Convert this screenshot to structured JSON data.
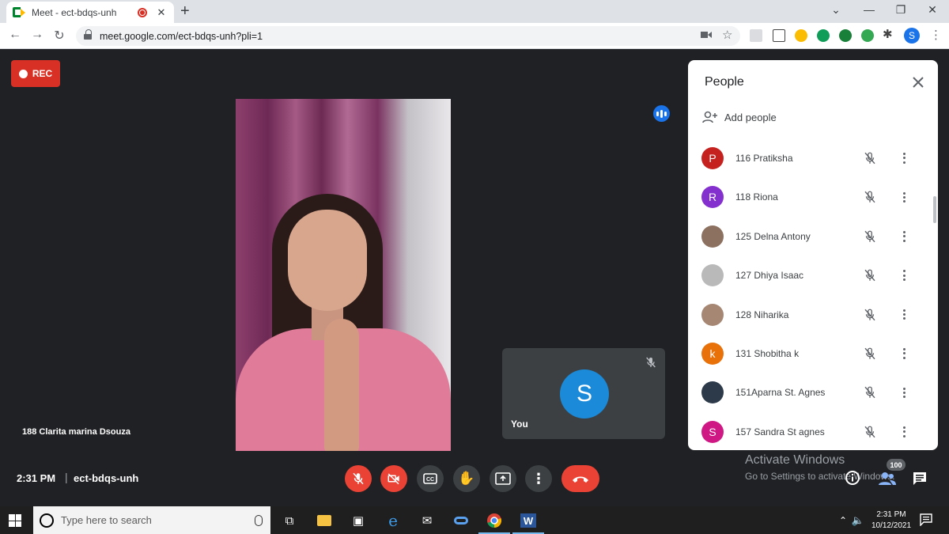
{
  "browser": {
    "tab_title": "Meet - ect-bdqs-unh",
    "tab_close": "✕",
    "new_tab": "+",
    "url": "meet.google.com/ect-bdqs-unh?pli=1",
    "profile_initial": "S",
    "window_controls": [
      "⌄",
      "—",
      "❐",
      "✕"
    ]
  },
  "meet": {
    "rec_label": "REC",
    "speaker_name": "188 Clarita marina Dsouza",
    "self_tile": {
      "initial": "S",
      "label": "You"
    },
    "clock": "2:31 PM",
    "separator": "|",
    "meeting_code": "ect-bdqs-unh",
    "participant_count": "100",
    "colors": {
      "accent": "#1a73e8",
      "danger": "#ea4335",
      "bg": "#202124",
      "tile": "#3c4043"
    }
  },
  "people_panel": {
    "title": "People",
    "add_people": "Add people",
    "participants": [
      {
        "name": "116 Pratiksha",
        "initial": "P",
        "avatar_color": "#c5221f"
      },
      {
        "name": "118 Riona",
        "initial": "R",
        "avatar_color": "#8430ce"
      },
      {
        "name": "125 Delna Antony",
        "initial": "",
        "avatar_color": "#8c7060"
      },
      {
        "name": "127 Dhiya Isaac",
        "initial": "",
        "avatar_color": "#b9b9b9"
      },
      {
        "name": "128 Niharika",
        "initial": "",
        "avatar_color": "#a58774"
      },
      {
        "name": "131 Shobitha k",
        "initial": "k",
        "avatar_color": "#e8710a"
      },
      {
        "name": "151Aparna St. Agnes",
        "initial": "",
        "avatar_color": "#2d3a4a"
      },
      {
        "name": "157 Sandra St agnes",
        "initial": "S",
        "avatar_color": "#d01884"
      }
    ]
  },
  "watermark": {
    "title": "Activate Windows",
    "subtitle": "Go to Settings to activate Windows."
  },
  "taskbar": {
    "search_placeholder": "Type here to search",
    "time": "2:31 PM",
    "date": "10/12/2021"
  }
}
